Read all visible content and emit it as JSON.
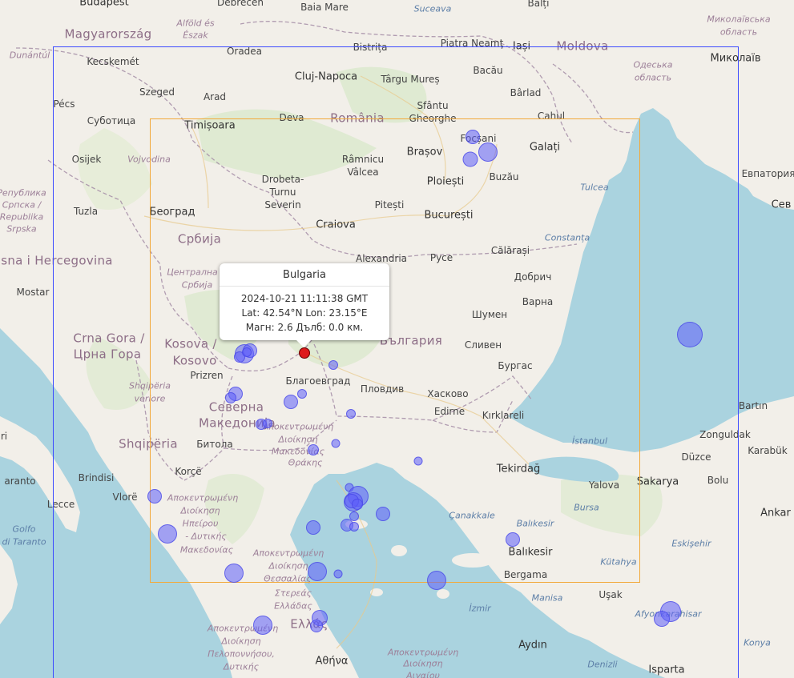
{
  "colors": {
    "land": "#f2efe9",
    "water": "#aad3df",
    "border": "#a993aa",
    "outer_rect": "#3d4bff",
    "inner_rect": "#f2a93b",
    "quake": "#5f5ffa",
    "selected_quake": "#dd1b1b"
  },
  "popup": {
    "title": "Bulgaria",
    "time": "2024-10-21 11:11:38 GMT",
    "coords": "Lat: 42.54°N Lon: 23.15°E",
    "details": "Магн: 2.6 Дълб: 0.0 км."
  },
  "labels": [
    {
      "text": "Budapest",
      "cls": "l-city"
    },
    {
      "text": "Debrecen",
      "cls": "l-town"
    },
    {
      "text": "Baia Mare",
      "cls": "l-town"
    },
    {
      "text": "Suceava",
      "cls": "l-water"
    },
    {
      "text": "Bălți",
      "cls": "l-town"
    },
    {
      "text": "Миколаївська",
      "cls": "l-region"
    },
    {
      "text": "область",
      "cls": "l-region"
    },
    {
      "text": "Magyarország",
      "cls": "l-country"
    },
    {
      "text": "Alföld és",
      "cls": "l-region"
    },
    {
      "text": "Észak",
      "cls": "l-region"
    },
    {
      "text": "Dunántúl",
      "cls": "l-region"
    },
    {
      "text": "Kecskemét",
      "cls": "l-town"
    },
    {
      "text": "Oradea",
      "cls": "l-town"
    },
    {
      "text": "Bistrița",
      "cls": "l-town"
    },
    {
      "text": "Piatra Neamț",
      "cls": "l-town"
    },
    {
      "text": "Iași",
      "cls": "l-city"
    },
    {
      "text": "Moldova",
      "cls": "l-country"
    },
    {
      "text": "Одеська",
      "cls": "l-region"
    },
    {
      "text": "область",
      "cls": "l-region"
    },
    {
      "text": "Миколаїв",
      "cls": "l-city"
    },
    {
      "text": "Cluj-Napoca",
      "cls": "l-city"
    },
    {
      "text": "Târgu Mureș",
      "cls": "l-town"
    },
    {
      "text": "Bacău",
      "cls": "l-town"
    },
    {
      "text": "Szeged",
      "cls": "l-town"
    },
    {
      "text": "Arad",
      "cls": "l-town"
    },
    {
      "text": "Bârlad",
      "cls": "l-town"
    },
    {
      "text": "Pécs",
      "cls": "l-town"
    },
    {
      "text": "Sfântu",
      "cls": "l-town"
    },
    {
      "text": "Gheorghe",
      "cls": "l-town"
    },
    {
      "text": "Cahul",
      "cls": "l-town"
    },
    {
      "text": "Суботица",
      "cls": "l-town"
    },
    {
      "text": "Timișoara",
      "cls": "l-city"
    },
    {
      "text": "Deva",
      "cls": "l-town"
    },
    {
      "text": "România",
      "cls": "l-country"
    },
    {
      "text": "Focșani",
      "cls": "l-town"
    },
    {
      "text": "Brașov",
      "cls": "l-city"
    },
    {
      "text": "Galați",
      "cls": "l-city"
    },
    {
      "text": "Osijek",
      "cls": "l-town"
    },
    {
      "text": "Vojvodina",
      "cls": "l-region"
    },
    {
      "text": "Râmnicu",
      "cls": "l-town"
    },
    {
      "text": "Vâlcea",
      "cls": "l-town"
    },
    {
      "text": "Buzău",
      "cls": "l-town"
    },
    {
      "text": "Евпатория",
      "cls": "l-town"
    },
    {
      "text": "Drobeta-",
      "cls": "l-town"
    },
    {
      "text": "Turnu",
      "cls": "l-town"
    },
    {
      "text": "Severin",
      "cls": "l-town"
    },
    {
      "text": "Ploiești",
      "cls": "l-city"
    },
    {
      "text": "Tulcea",
      "cls": "l-water"
    },
    {
      "text": "Република",
      "cls": "l-region"
    },
    {
      "text": "Српска /",
      "cls": "l-region"
    },
    {
      "text": "Republika",
      "cls": "l-region"
    },
    {
      "text": "Srpska",
      "cls": "l-region"
    },
    {
      "text": "Tuzla",
      "cls": "l-town"
    },
    {
      "text": "Београд",
      "cls": "l-city"
    },
    {
      "text": "Pitești",
      "cls": "l-town"
    },
    {
      "text": "București",
      "cls": "l-city"
    },
    {
      "text": "Сев",
      "cls": "l-city"
    },
    {
      "text": "Craiova",
      "cls": "l-city"
    },
    {
      "text": "Constanța",
      "cls": "l-water"
    },
    {
      "text": "Србија",
      "cls": "l-country"
    },
    {
      "text": "Alexandria",
      "cls": "l-town"
    },
    {
      "text": "Русе",
      "cls": "l-town"
    },
    {
      "text": "Călărași",
      "cls": "l-town"
    },
    {
      "text": "sna i Hercegovina",
      "cls": "l-country"
    },
    {
      "text": "Централна",
      "cls": "l-region"
    },
    {
      "text": "Србија",
      "cls": "l-region"
    },
    {
      "text": "Добрич",
      "cls": "l-town"
    },
    {
      "text": "Mostar",
      "cls": "l-town"
    },
    {
      "text": "Варна",
      "cls": "l-town"
    },
    {
      "text": "Шумен",
      "cls": "l-town"
    },
    {
      "text": "Crna Gora /",
      "cls": "l-country"
    },
    {
      "text": "Црна Гора",
      "cls": "l-country"
    },
    {
      "text": "Kosova /",
      "cls": "l-country"
    },
    {
      "text": "Kosovo",
      "cls": "l-country"
    },
    {
      "text": "България",
      "cls": "l-country"
    },
    {
      "text": "Сливен",
      "cls": "l-town"
    },
    {
      "text": "Бургас",
      "cls": "l-town"
    },
    {
      "text": "Prizren",
      "cls": "l-town"
    },
    {
      "text": "Благоевград",
      "cls": "l-town"
    },
    {
      "text": "Shqipëria",
      "cls": "l-region"
    },
    {
      "text": "veriore",
      "cls": "l-region"
    },
    {
      "text": "Пловдив",
      "cls": "l-town"
    },
    {
      "text": "Хасково",
      "cls": "l-town"
    },
    {
      "text": "Северна",
      "cls": "l-country"
    },
    {
      "text": "Македонија",
      "cls": "l-country"
    },
    {
      "text": "Edirne",
      "cls": "l-town"
    },
    {
      "text": "Kırklareli",
      "cls": "l-town"
    },
    {
      "text": "Bartın",
      "cls": "l-town"
    },
    {
      "text": "Zonguldak",
      "cls": "l-town"
    },
    {
      "text": "Karabük",
      "cls": "l-town"
    },
    {
      "text": "Shqipëria",
      "cls": "l-country"
    },
    {
      "text": "Битола",
      "cls": "l-town"
    },
    {
      "text": "Αποκεντρωμένη",
      "cls": "l-region"
    },
    {
      "text": "Διοίκηση",
      "cls": "l-region"
    },
    {
      "text": "Μακεδονίας",
      "cls": "l-region"
    },
    {
      "text": "Θράκης",
      "cls": "l-region"
    },
    {
      "text": "İstanbul",
      "cls": "l-water"
    },
    {
      "text": "Düzce",
      "cls": "l-town"
    },
    {
      "text": "Tekirdağ",
      "cls": "l-city"
    },
    {
      "text": "Korçë",
      "cls": "l-town"
    },
    {
      "text": "Brindisi",
      "cls": "l-town"
    },
    {
      "text": "aranto",
      "cls": "l-town"
    },
    {
      "text": "Yalova",
      "cls": "l-town"
    },
    {
      "text": "Sakarya",
      "cls": "l-city"
    },
    {
      "text": "Bolu",
      "cls": "l-town"
    },
    {
      "text": "Vlorë",
      "cls": "l-town"
    },
    {
      "text": "Αποκεντρωμένη",
      "cls": "l-region"
    },
    {
      "text": "Διοίκηση",
      "cls": "l-region"
    },
    {
      "text": "Ηπείρου",
      "cls": "l-region"
    },
    {
      "text": "- Δυτικής",
      "cls": "l-region"
    },
    {
      "text": "Μακεδονίας",
      "cls": "l-region"
    },
    {
      "text": "Lecce",
      "cls": "l-town"
    },
    {
      "text": "Bursa",
      "cls": "l-water"
    },
    {
      "text": "Ankar",
      "cls": "l-city"
    },
    {
      "text": "Çanakkale",
      "cls": "l-water"
    },
    {
      "text": "Golfo",
      "cls": "l-water"
    },
    {
      "text": "di Taranto",
      "cls": "l-water"
    },
    {
      "text": "Balıkesir",
      "cls": "l-water"
    },
    {
      "text": "Balıkesir",
      "cls": "l-city"
    },
    {
      "text": "Eskişehir",
      "cls": "l-water"
    },
    {
      "text": "Αποκεντρωμένη",
      "cls": "l-region"
    },
    {
      "text": "Διοίκηση",
      "cls": "l-region"
    },
    {
      "text": "Θεσσαλίας",
      "cls": "l-region"
    },
    {
      "text": "Στερεάς",
      "cls": "l-region"
    },
    {
      "text": "Ελλάδας",
      "cls": "l-region"
    },
    {
      "text": "Kütahya",
      "cls": "l-water"
    },
    {
      "text": "Bergama",
      "cls": "l-town"
    },
    {
      "text": "Manisa",
      "cls": "l-water"
    },
    {
      "text": "Uşak",
      "cls": "l-town"
    },
    {
      "text": "İzmir",
      "cls": "l-water"
    },
    {
      "text": "Ελλάς",
      "cls": "l-country"
    },
    {
      "text": "Afyonkarahisar",
      "cls": "l-water"
    },
    {
      "text": "Αποκεντρωμένη",
      "cls": "l-region"
    },
    {
      "text": "Διοίκηση",
      "cls": "l-region"
    },
    {
      "text": "Πελοποννήσου,",
      "cls": "l-region"
    },
    {
      "text": "Δυτικής",
      "cls": "l-region"
    },
    {
      "text": "Αποκεντρωμένη",
      "cls": "l-region"
    },
    {
      "text": "Διοίκηση",
      "cls": "l-region"
    },
    {
      "text": "Αιγαίου",
      "cls": "l-region"
    },
    {
      "text": "Aydın",
      "cls": "l-city"
    },
    {
      "text": "Denizli",
      "cls": "l-water"
    },
    {
      "text": "Konya",
      "cls": "l-water"
    },
    {
      "text": "Isparta",
      "cls": "l-city"
    },
    {
      "text": "Αθήνα",
      "cls": "l-city"
    },
    {
      "text": "ri",
      "cls": "l-town"
    }
  ]
}
